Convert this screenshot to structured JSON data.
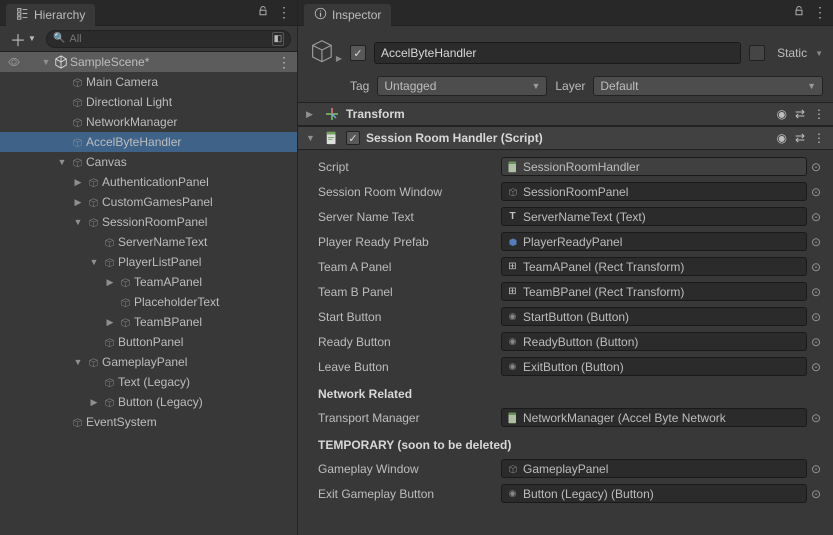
{
  "hierarchy": {
    "tab_label": "Hierarchy",
    "search_placeholder": "All",
    "scene_name": "SampleScene*",
    "items": [
      {
        "label": "Main Camera",
        "indent": 1,
        "fold": "none"
      },
      {
        "label": "Directional Light",
        "indent": 1,
        "fold": "none"
      },
      {
        "label": "NetworkManager",
        "indent": 1,
        "fold": "none"
      },
      {
        "label": "AccelByteHandler",
        "indent": 1,
        "fold": "none",
        "selected": true
      },
      {
        "label": "Canvas",
        "indent": 1,
        "fold": "open"
      },
      {
        "label": "AuthenticationPanel",
        "indent": 2,
        "fold": "closed"
      },
      {
        "label": "CustomGamesPanel",
        "indent": 2,
        "fold": "closed"
      },
      {
        "label": "SessionRoomPanel",
        "indent": 2,
        "fold": "open"
      },
      {
        "label": "ServerNameText",
        "indent": 3,
        "fold": "none"
      },
      {
        "label": "PlayerListPanel",
        "indent": 3,
        "fold": "open"
      },
      {
        "label": "TeamAPanel",
        "indent": 4,
        "fold": "closed"
      },
      {
        "label": "PlaceholderText",
        "indent": 4,
        "fold": "none"
      },
      {
        "label": "TeamBPanel",
        "indent": 4,
        "fold": "closed"
      },
      {
        "label": "ButtonPanel",
        "indent": 3,
        "fold": "none"
      },
      {
        "label": "GameplayPanel",
        "indent": 2,
        "fold": "open"
      },
      {
        "label": "Text (Legacy)",
        "indent": 3,
        "fold": "none"
      },
      {
        "label": "Button (Legacy)",
        "indent": 3,
        "fold": "closed"
      },
      {
        "label": "EventSystem",
        "indent": 1,
        "fold": "none"
      }
    ]
  },
  "inspector": {
    "tab_label": "Inspector",
    "object_name": "AccelByteHandler",
    "enabled": true,
    "static_label": "Static",
    "tag_label": "Tag",
    "tag_value": "Untagged",
    "layer_label": "Layer",
    "layer_value": "Default",
    "transform_title": "Transform",
    "script_title": "Session Room Handler (Script)",
    "props": [
      {
        "label": "Script",
        "value": "SessionRoomHandler",
        "readonly": true,
        "icon": "script"
      },
      {
        "label": "Session Room Window",
        "value": "SessionRoomPanel",
        "icon": "cube"
      },
      {
        "label": "Server Name Text",
        "value": "ServerNameText (Text)",
        "icon": "text"
      },
      {
        "label": "Player Ready Prefab",
        "value": "PlayerReadyPanel",
        "icon": "prefab"
      },
      {
        "label": "Team A Panel",
        "value": "TeamAPanel (Rect Transform)",
        "icon": "rect"
      },
      {
        "label": "Team B Panel",
        "value": "TeamBPanel (Rect Transform)",
        "icon": "rect"
      },
      {
        "label": "Start Button",
        "value": "StartButton (Button)",
        "icon": "button"
      },
      {
        "label": "Ready Button",
        "value": "ReadyButton (Button)",
        "icon": "button"
      },
      {
        "label": "Leave Button",
        "value": "ExitButton (Button)",
        "icon": "button"
      }
    ],
    "section_network": "Network Related",
    "prop_network": {
      "label": "Transport Manager",
      "value": "NetworkManager (Accel Byte Network",
      "icon": "script"
    },
    "section_temp": "TEMPORARY (soon to be deleted)",
    "props_temp": [
      {
        "label": "Gameplay Window",
        "value": "GameplayPanel",
        "icon": "cube"
      },
      {
        "label": "Exit Gameplay Button",
        "value": "Button (Legacy) (Button)",
        "icon": "button"
      }
    ]
  }
}
